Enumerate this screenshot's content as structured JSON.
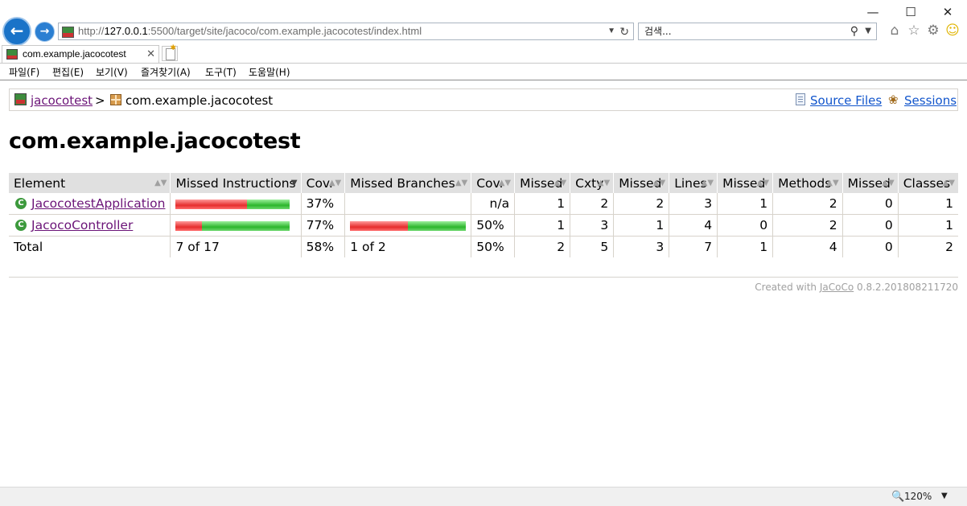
{
  "window": {
    "minimize": "—",
    "maximize": "☐",
    "close": "✕"
  },
  "browser": {
    "url_prefix": "http://",
    "url_host": "127.0.0.1",
    "url_rest": ":5500/target/site/jacoco/com.example.jacocotest/index.html",
    "search_placeholder": "검색...",
    "tab_title": "com.example.jacocotest",
    "icons": [
      "back-arrow-icon",
      "forward-arrow-icon",
      "refresh-icon",
      "search-icon",
      "home-icon",
      "favorites-star-icon",
      "settings-gear-icon",
      "smiley-icon"
    ]
  },
  "menu": [
    "파일(F)",
    "편집(E)",
    "보기(V)",
    "즐겨찾기(A)",
    "도구(T)",
    "도움말(H)"
  ],
  "breadcrumb": {
    "root": "jacocotest",
    "separator": ">",
    "current": "com.example.jacocotest",
    "source_files": "Source Files",
    "sessions": "Sessions"
  },
  "page_title": "com.example.jacocotest",
  "table": {
    "headers": [
      "Element",
      "Missed Instructions",
      "Cov.",
      "Missed Branches",
      "Cov.",
      "Missed",
      "Cxty",
      "Missed",
      "Lines",
      "Missed",
      "Methods",
      "Missed",
      "Classes"
    ],
    "sorted_column": 1,
    "rows": [
      {
        "name": "JacocotestApplication",
        "instr_missed_frac": 0.63,
        "instr_cov": "37%",
        "branch_missed_frac": null,
        "branch_cov": "n/a",
        "cxty_missed": "1",
        "cxty": "2",
        "lines_missed": "2",
        "lines": "3",
        "methods_missed": "1",
        "methods": "2",
        "classes_missed": "0",
        "classes": "1"
      },
      {
        "name": "JacocoController",
        "instr_missed_frac": 0.23,
        "instr_cov": "77%",
        "branch_missed_frac": 0.5,
        "branch_cov": "50%",
        "cxty_missed": "1",
        "cxty": "3",
        "lines_missed": "1",
        "lines": "4",
        "methods_missed": "0",
        "methods": "2",
        "classes_missed": "0",
        "classes": "1"
      }
    ],
    "total": {
      "label": "Total",
      "instr": "7 of 17",
      "instr_cov": "58%",
      "branch": "1 of 2",
      "branch_cov": "50%",
      "cxty_missed": "2",
      "cxty": "5",
      "lines_missed": "3",
      "lines": "7",
      "methods_missed": "1",
      "methods": "4",
      "classes_missed": "0",
      "classes": "2"
    }
  },
  "footer": {
    "prefix": "Created with",
    "link": "JaCoCo",
    "version": "0.8.2.201808211720"
  },
  "status": {
    "zoom": "120%"
  }
}
